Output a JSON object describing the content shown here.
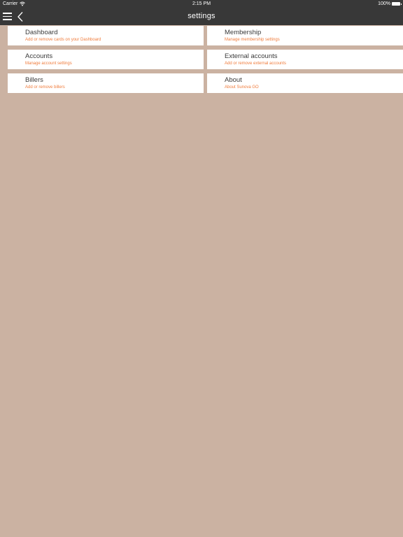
{
  "status_bar": {
    "carrier": "Carrier",
    "time": "2:15 PM",
    "battery": "100%"
  },
  "nav": {
    "title": "settings"
  },
  "settings": {
    "left": [
      {
        "title": "Dashboard",
        "subtitle": "Add or remove cards on your Dashboard"
      },
      {
        "title": "Accounts",
        "subtitle": "Manage account settings"
      },
      {
        "title": "Billers",
        "subtitle": "Add or remove billers"
      }
    ],
    "right": [
      {
        "title": "Membership",
        "subtitle": "Manage membership settings"
      },
      {
        "title": "External accounts",
        "subtitle": "Add or remove external accounts"
      },
      {
        "title": "About",
        "subtitle": "About Sunova GO"
      }
    ]
  },
  "colors": {
    "background": "#cbb2a2",
    "header": "#383838",
    "accent": "#f07c3c",
    "card": "#ffffff"
  },
  "icons": {
    "menu": "hamburger-menu-icon",
    "back": "chevron-left-icon",
    "wifi": "wifi-icon",
    "battery": "battery-icon"
  }
}
